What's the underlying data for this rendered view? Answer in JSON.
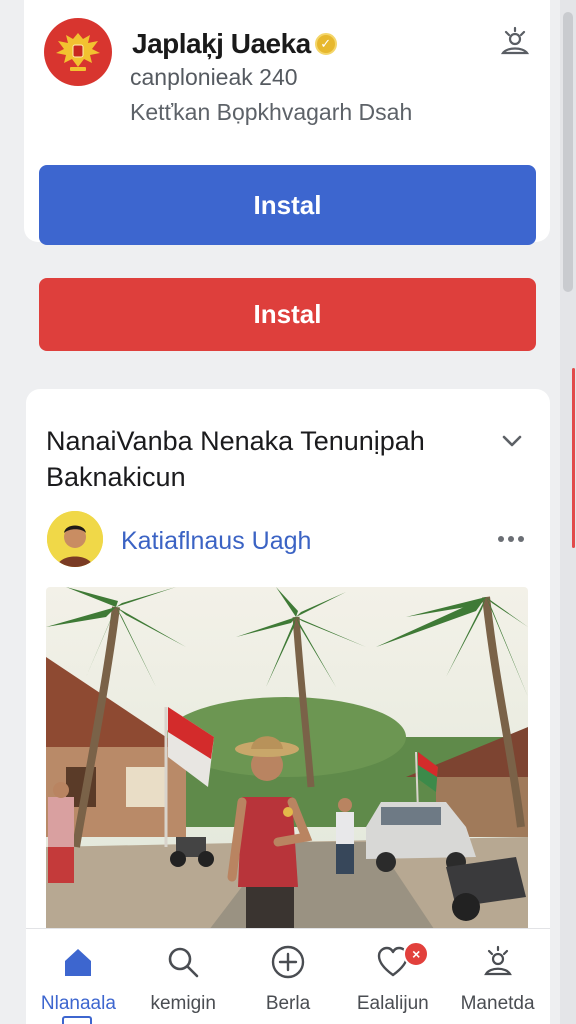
{
  "app": {
    "title": "Japlaķj Uaeka",
    "verified_icon": "verified-badge-icon",
    "subtitle": "canplonieak 240",
    "description": "Ketťkan Bọpkhvagarh Dsah",
    "settings_icon": "settings-icon"
  },
  "buttons": {
    "install_primary": "Instal",
    "install_secondary": "Instal",
    "primary_color": "#3d66cf",
    "secondary_color": "#de3f3c"
  },
  "post": {
    "title": "NanaiVanba Nenaka Tenunịpah Baknakicun",
    "author": "Katiaflnaus Uagh",
    "photo": "village-street-with-flags-photo"
  },
  "nav": {
    "items": [
      {
        "label": "Nlanaala",
        "icon": "home-icon",
        "active": true
      },
      {
        "label": "kemigin",
        "icon": "search-icon",
        "active": false
      },
      {
        "label": "Berla",
        "icon": "add-circle-icon",
        "active": false
      },
      {
        "label": "Ealalijun",
        "icon": "heart-notification-icon",
        "badge": "×",
        "active": false
      },
      {
        "label": "Manetda",
        "icon": "profile-icon",
        "active": false
      }
    ]
  }
}
